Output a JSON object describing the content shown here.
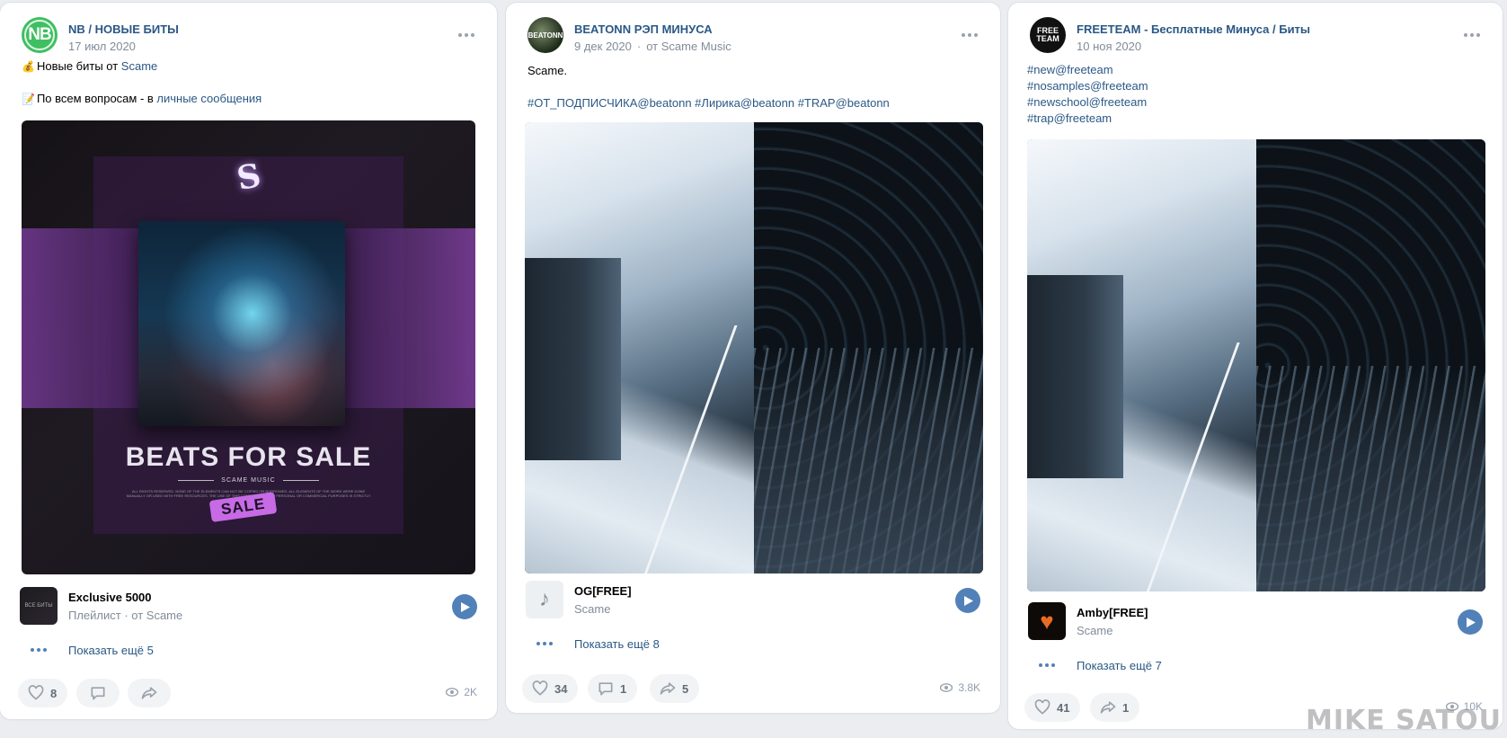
{
  "posts": [
    {
      "author": "NB / НОВЫЕ БИТЫ",
      "avatar_text": "NB",
      "date": "17 июл 2020",
      "text_line1_emoji": "💰",
      "text_line1_prefix": "Новые биты от ",
      "text_line1_link": "Scame",
      "text_line2_emoji": "📝",
      "text_line2_prefix": "По всем вопросам - в ",
      "text_line2_link": "личные сообщения",
      "cover": {
        "title": "BEATS FOR SALE",
        "subtitle": "SCAME MUSIC",
        "fine_print": "ALL RIGHTS RESERVED. NONE OF THE ELEMENTS CAN NOT BE COPIED OR BORROWED. ALL ELEMENTS OF THE WORK WERE DONE MANUALLY OR USED WITH FREE RESOURCES. THE USE OF THIS COMPOSITION FOR PERSONAL OR COMMERCIAL PURPOSES IS STRICTLY PROHIBITED!",
        "badge": "SALE"
      },
      "attachment": {
        "thumb_text": "ВСЕ БИТЫ",
        "title": "Exclusive 5000",
        "subtitle": "Плейлист · от Scame"
      },
      "show_more": "Показать ещё 5",
      "likes": "8",
      "views": "2K"
    },
    {
      "author": "BEATONN РЭП МИНУСА",
      "avatar_text": "BEATONN",
      "date": "9 дек 2020",
      "from": "от Scame Music",
      "text": "Scame.",
      "hashtags": "#ОТ_ПОДПИСЧИКА@beatonn #Лирика@beatonn #TRAP@beatonn",
      "attachment": {
        "title": "OG[FREE]",
        "subtitle": "Scame"
      },
      "show_more": "Показать ещё 8",
      "likes": "34",
      "comments": "1",
      "shares": "5",
      "views": "3.8K"
    },
    {
      "author": "FREETEAM - Бесплатные Минуса / Биты",
      "avatar_text": "FREE TEAM",
      "date": "10 ноя 2020",
      "hashtags": [
        "#new@freeteam",
        "#nosamples@freeteam",
        "#newschool@freeteam",
        "#trap@freeteam"
      ],
      "attachment": {
        "title": "Amby[FREE]",
        "subtitle": "Scame"
      },
      "show_more": "Показать ещё 7",
      "likes": "41",
      "shares": "1",
      "views": "10K"
    }
  ],
  "watermark": "MIKE SATOU",
  "colors": {
    "link": "#2a5885",
    "accent": "#5181b8",
    "secondary_text": "#818c99",
    "background": "#ebedf0"
  },
  "icons": [
    "more-icon",
    "play-icon",
    "like-icon",
    "comment-icon",
    "share-icon",
    "views-icon",
    "music-note-icon"
  ]
}
